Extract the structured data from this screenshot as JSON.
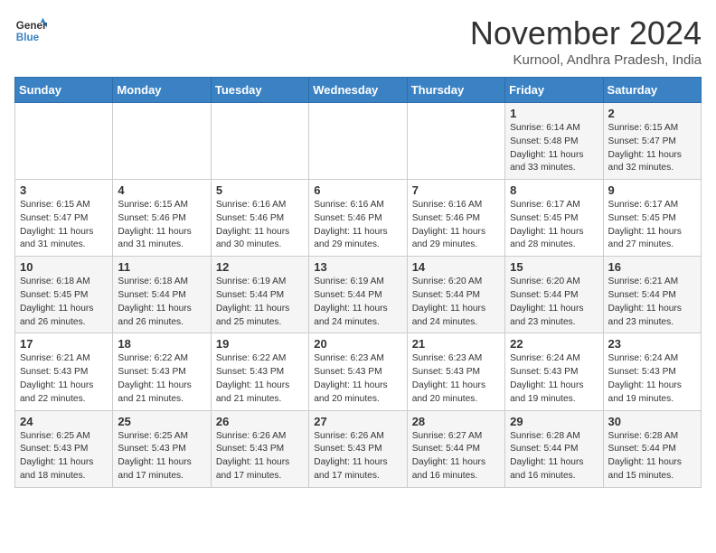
{
  "header": {
    "logo_line1": "General",
    "logo_line2": "Blue",
    "month_title": "November 2024",
    "location": "Kurnool, Andhra Pradesh, India"
  },
  "weekdays": [
    "Sunday",
    "Monday",
    "Tuesday",
    "Wednesday",
    "Thursday",
    "Friday",
    "Saturday"
  ],
  "weeks": [
    [
      {
        "day": "",
        "info": ""
      },
      {
        "day": "",
        "info": ""
      },
      {
        "day": "",
        "info": ""
      },
      {
        "day": "",
        "info": ""
      },
      {
        "day": "",
        "info": ""
      },
      {
        "day": "1",
        "info": "Sunrise: 6:14 AM\nSunset: 5:48 PM\nDaylight: 11 hours\nand 33 minutes."
      },
      {
        "day": "2",
        "info": "Sunrise: 6:15 AM\nSunset: 5:47 PM\nDaylight: 11 hours\nand 32 minutes."
      }
    ],
    [
      {
        "day": "3",
        "info": "Sunrise: 6:15 AM\nSunset: 5:47 PM\nDaylight: 11 hours\nand 31 minutes."
      },
      {
        "day": "4",
        "info": "Sunrise: 6:15 AM\nSunset: 5:46 PM\nDaylight: 11 hours\nand 31 minutes."
      },
      {
        "day": "5",
        "info": "Sunrise: 6:16 AM\nSunset: 5:46 PM\nDaylight: 11 hours\nand 30 minutes."
      },
      {
        "day": "6",
        "info": "Sunrise: 6:16 AM\nSunset: 5:46 PM\nDaylight: 11 hours\nand 29 minutes."
      },
      {
        "day": "7",
        "info": "Sunrise: 6:16 AM\nSunset: 5:46 PM\nDaylight: 11 hours\nand 29 minutes."
      },
      {
        "day": "8",
        "info": "Sunrise: 6:17 AM\nSunset: 5:45 PM\nDaylight: 11 hours\nand 28 minutes."
      },
      {
        "day": "9",
        "info": "Sunrise: 6:17 AM\nSunset: 5:45 PM\nDaylight: 11 hours\nand 27 minutes."
      }
    ],
    [
      {
        "day": "10",
        "info": "Sunrise: 6:18 AM\nSunset: 5:45 PM\nDaylight: 11 hours\nand 26 minutes."
      },
      {
        "day": "11",
        "info": "Sunrise: 6:18 AM\nSunset: 5:44 PM\nDaylight: 11 hours\nand 26 minutes."
      },
      {
        "day": "12",
        "info": "Sunrise: 6:19 AM\nSunset: 5:44 PM\nDaylight: 11 hours\nand 25 minutes."
      },
      {
        "day": "13",
        "info": "Sunrise: 6:19 AM\nSunset: 5:44 PM\nDaylight: 11 hours\nand 24 minutes."
      },
      {
        "day": "14",
        "info": "Sunrise: 6:20 AM\nSunset: 5:44 PM\nDaylight: 11 hours\nand 24 minutes."
      },
      {
        "day": "15",
        "info": "Sunrise: 6:20 AM\nSunset: 5:44 PM\nDaylight: 11 hours\nand 23 minutes."
      },
      {
        "day": "16",
        "info": "Sunrise: 6:21 AM\nSunset: 5:44 PM\nDaylight: 11 hours\nand 23 minutes."
      }
    ],
    [
      {
        "day": "17",
        "info": "Sunrise: 6:21 AM\nSunset: 5:43 PM\nDaylight: 11 hours\nand 22 minutes."
      },
      {
        "day": "18",
        "info": "Sunrise: 6:22 AM\nSunset: 5:43 PM\nDaylight: 11 hours\nand 21 minutes."
      },
      {
        "day": "19",
        "info": "Sunrise: 6:22 AM\nSunset: 5:43 PM\nDaylight: 11 hours\nand 21 minutes."
      },
      {
        "day": "20",
        "info": "Sunrise: 6:23 AM\nSunset: 5:43 PM\nDaylight: 11 hours\nand 20 minutes."
      },
      {
        "day": "21",
        "info": "Sunrise: 6:23 AM\nSunset: 5:43 PM\nDaylight: 11 hours\nand 20 minutes."
      },
      {
        "day": "22",
        "info": "Sunrise: 6:24 AM\nSunset: 5:43 PM\nDaylight: 11 hours\nand 19 minutes."
      },
      {
        "day": "23",
        "info": "Sunrise: 6:24 AM\nSunset: 5:43 PM\nDaylight: 11 hours\nand 19 minutes."
      }
    ],
    [
      {
        "day": "24",
        "info": "Sunrise: 6:25 AM\nSunset: 5:43 PM\nDaylight: 11 hours\nand 18 minutes."
      },
      {
        "day": "25",
        "info": "Sunrise: 6:25 AM\nSunset: 5:43 PM\nDaylight: 11 hours\nand 17 minutes."
      },
      {
        "day": "26",
        "info": "Sunrise: 6:26 AM\nSunset: 5:43 PM\nDaylight: 11 hours\nand 17 minutes."
      },
      {
        "day": "27",
        "info": "Sunrise: 6:26 AM\nSunset: 5:43 PM\nDaylight: 11 hours\nand 17 minutes."
      },
      {
        "day": "28",
        "info": "Sunrise: 6:27 AM\nSunset: 5:44 PM\nDaylight: 11 hours\nand 16 minutes."
      },
      {
        "day": "29",
        "info": "Sunrise: 6:28 AM\nSunset: 5:44 PM\nDaylight: 11 hours\nand 16 minutes."
      },
      {
        "day": "30",
        "info": "Sunrise: 6:28 AM\nSunset: 5:44 PM\nDaylight: 11 hours\nand 15 minutes."
      }
    ]
  ]
}
